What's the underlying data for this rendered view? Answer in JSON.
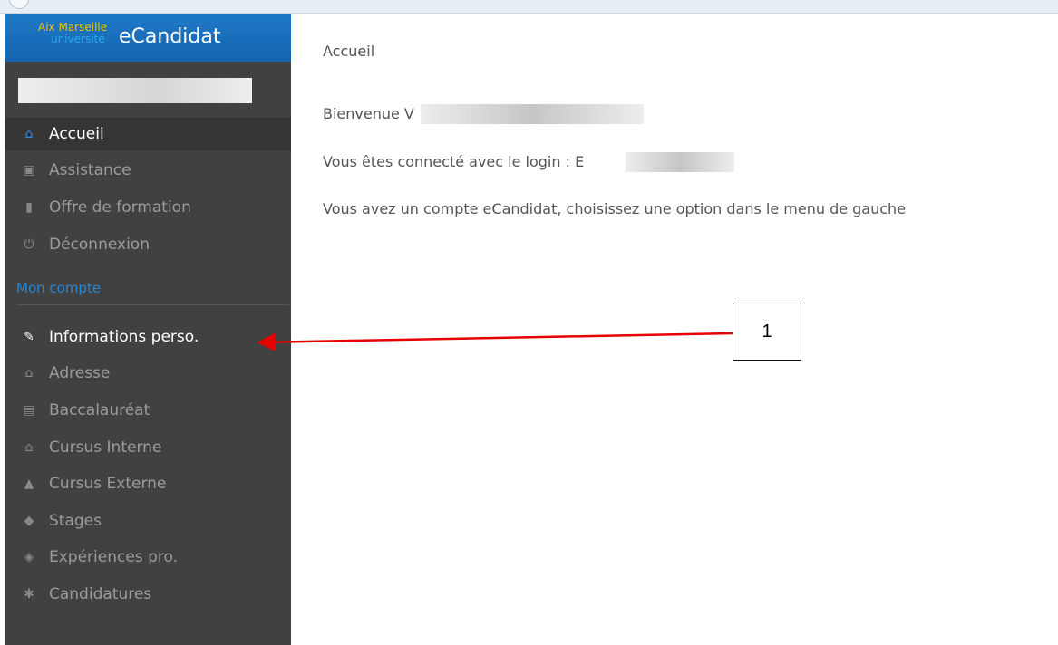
{
  "brand": {
    "logo_line1": "Aix Marseille",
    "logo_line2": "université",
    "title": "eCandidat"
  },
  "sidebar": {
    "main_items": [
      {
        "label": "Accueil",
        "icon": "home-icon"
      },
      {
        "label": "Assistance",
        "icon": "ambulance-icon"
      },
      {
        "label": "Offre de formation",
        "icon": "bookmark-icon"
      },
      {
        "label": "Déconnexion",
        "icon": "power-icon"
      }
    ],
    "section_title": "Mon compte",
    "account_items": [
      {
        "label": "Informations perso.",
        "icon": "pencil-icon"
      },
      {
        "label": "Adresse",
        "icon": "house-icon"
      },
      {
        "label": "Baccalauréat",
        "icon": "book-icon"
      },
      {
        "label": "Cursus Interne",
        "icon": "institution-icon"
      },
      {
        "label": "Cursus Externe",
        "icon": "graduation-cap-icon"
      },
      {
        "label": "Stages",
        "icon": "cube-icon"
      },
      {
        "label": "Expériences pro.",
        "icon": "cubes-icon"
      },
      {
        "label": "Candidatures",
        "icon": "asterisk-icon"
      }
    ]
  },
  "main": {
    "page_title": "Accueil",
    "welcome": "Bienvenue V",
    "login_text": "Vous êtes connecté avec le login : E",
    "info_text": "Vous avez un compte eCandidat, choisissez une option dans le menu de gauche"
  },
  "annotation": {
    "callout_number": "1",
    "arrow_color": "#e60000"
  },
  "colors": {
    "brand_blue": "#1a6fbd",
    "sidebar_bg": "#414141",
    "active_icon": "#2a8ee8",
    "section_blue": "#2c84d0"
  }
}
